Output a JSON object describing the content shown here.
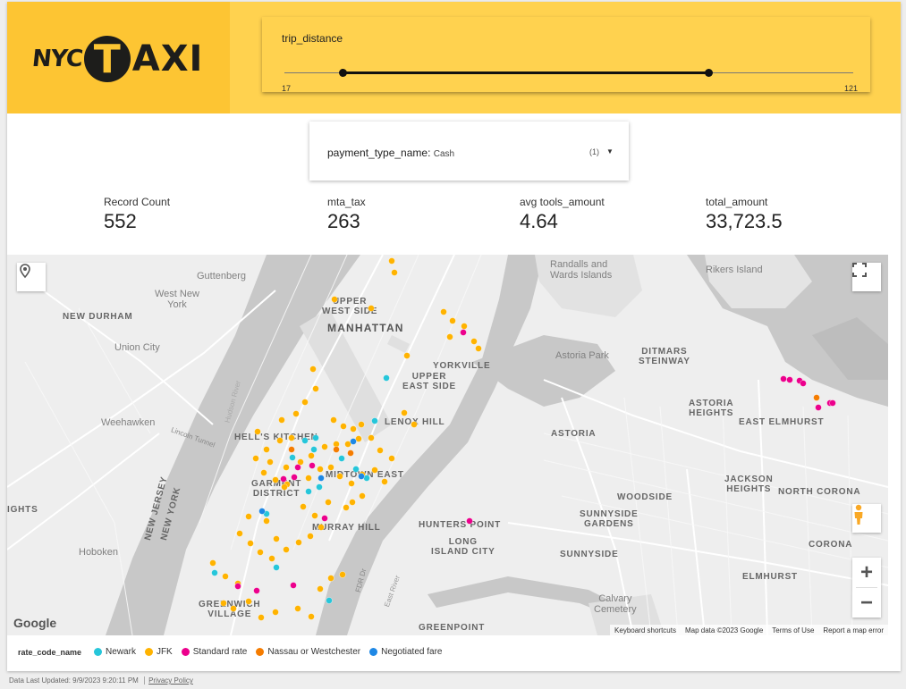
{
  "logo": {
    "nyc": "NYC",
    "t": "T",
    "axi": "AXI"
  },
  "slider": {
    "title": "trip_distance",
    "min_label": "17",
    "max_label": "121",
    "range_low_fraction": 0.1,
    "range_high_fraction": 0.745
  },
  "filter": {
    "name": "payment_type_name",
    "value": "Cash",
    "count": "(1)"
  },
  "kpis": [
    {
      "label": "Record Count",
      "value": "552"
    },
    {
      "label": "mta_tax",
      "value": "263"
    },
    {
      "label": "avg tools_amount",
      "value": "4.64"
    },
    {
      "label": "total_amount",
      "value": "33,723.5"
    }
  ],
  "map": {
    "labels": {
      "guttenberg": "Guttenberg",
      "west_new_york": "West New\nYork",
      "new_durham": "NEW DURHAM",
      "union_city": "Union City",
      "weehawken": "Weehawken",
      "hoboken": "Hoboken",
      "new_jersey": "NEW JERSEY",
      "new_york": "NEW YORK",
      "heights": "IGHTS",
      "upper_west_side": "UPPER\nWEST SIDE",
      "manhattan": "MANHATTAN",
      "yorkville": "YORKVILLE",
      "upper_east_side": "UPPER\nEAST SIDE",
      "lenox_hill": "LENOX HILL",
      "hells_kitchen": "HELL'S KITCHEN",
      "midtown_east": "MIDTOWN EAST",
      "garment_district": "GARMENT\nDISTRICT",
      "murray_hill": "MURRAY HILL",
      "greenwich_village": "GREENWICH\nVILLAGE",
      "randalls": "Randalls and\nWards Islands",
      "rikers": "Rikers Island",
      "astoria_park": "Astoria Park",
      "ditmars": "DITMARS\nSTEINWAY",
      "astoria_heights": "ASTORIA\nHEIGHTS",
      "east_elmhurst": "EAST ELMHURST",
      "astoria": "ASTORIA",
      "jackson_heights": "JACKSON\nHEIGHTS",
      "north_corona": "NORTH CORONA",
      "woodside": "WOODSIDE",
      "sunnyside_gardens": "SUNNYSIDE\nGARDENS",
      "hunters_point": "HUNTERS POINT",
      "long_island_city": "LONG\nISLAND CITY",
      "sunnyside": "SUNNYSIDE",
      "corona": "CORONA",
      "elmhurst": "ELMHURST",
      "calvary": "Calvary\nCemetery",
      "greenpoint": "GREENPOINT",
      "lincoln_tunnel": "Lincoln Tunnel",
      "fdr_dr": "FDR Dr",
      "east_river": "East River",
      "hudson_river": "Hudson River"
    },
    "google": "Google",
    "attribution": [
      "Keyboard shortcuts",
      "Map data ©2023 Google",
      "Terms of Use",
      "Report a map error"
    ]
  },
  "legend": {
    "title": "rate_code_name",
    "items": [
      {
        "label": "Newark",
        "color": "#26c6da"
      },
      {
        "label": "JFK",
        "color": "#ffb300"
      },
      {
        "label": "Standard rate",
        "color": "#ec008c"
      },
      {
        "label": "Nassau or Westchester",
        "color": "#f57c00"
      },
      {
        "label": "Negotiated fare",
        "color": "#1e88e5"
      }
    ]
  },
  "footer": {
    "updated": "Data Last Updated: 9/9/2023 9:20:11 PM",
    "privacy": "Privacy Policy"
  }
}
